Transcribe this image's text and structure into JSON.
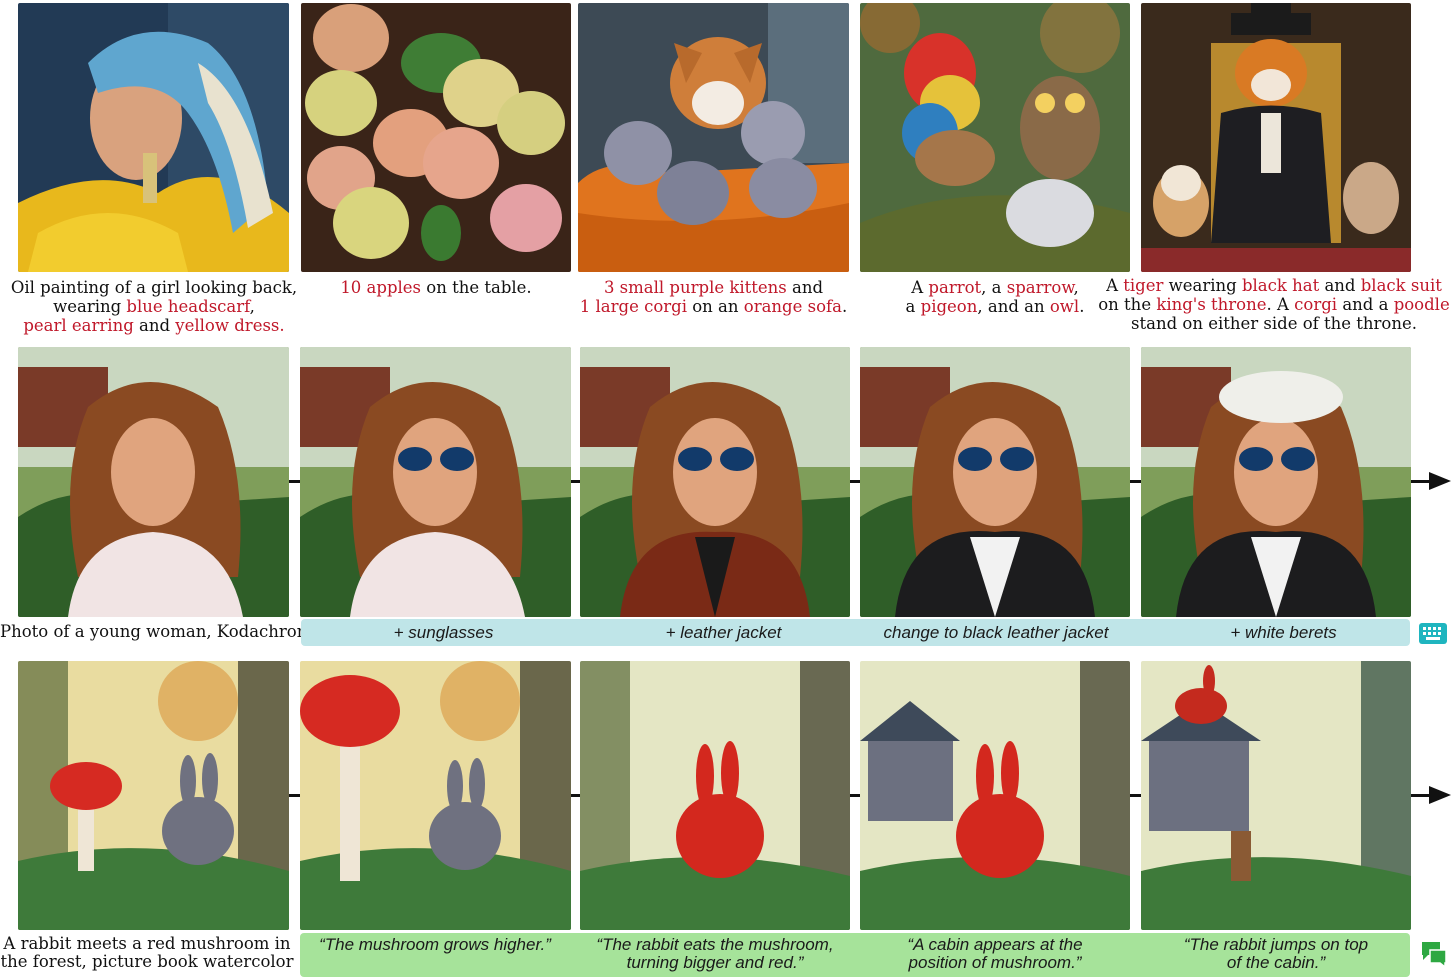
{
  "row1": {
    "captions": [
      {
        "parts": [
          {
            "t": "Oil painting of a girl looking back,",
            "h": false,
            "br": true
          },
          {
            "t": "wearing ",
            "h": false
          },
          {
            "t": "blue headscarf",
            "h": true
          },
          {
            "t": ",",
            "h": false,
            "br": true
          },
          {
            "t": "pearl earring",
            "h": true
          },
          {
            "t": " and ",
            "h": false
          },
          {
            "t": "yellow dress",
            "h": true
          },
          {
            "t": ".",
            "h": true
          }
        ]
      },
      {
        "parts": [
          {
            "t": "10 apples",
            "h": true
          },
          {
            "t": " on the table.",
            "h": false
          }
        ]
      },
      {
        "parts": [
          {
            "t": "3 small purple kittens",
            "h": true
          },
          {
            "t": " and",
            "h": false,
            "br": true
          },
          {
            "t": "1 large corgi",
            "h": true
          },
          {
            "t": " on an ",
            "h": false
          },
          {
            "t": "orange sofa",
            "h": true
          },
          {
            "t": ".",
            "h": false
          }
        ]
      },
      {
        "parts": [
          {
            "t": "A ",
            "h": false
          },
          {
            "t": "parrot",
            "h": true
          },
          {
            "t": ", a ",
            "h": false
          },
          {
            "t": "sparrow",
            "h": true
          },
          {
            "t": ",",
            "h": false,
            "br": true
          },
          {
            "t": "a ",
            "h": false
          },
          {
            "t": "pigeon",
            "h": true
          },
          {
            "t": ", and an ",
            "h": false
          },
          {
            "t": "owl",
            "h": true
          },
          {
            "t": ".",
            "h": false
          }
        ]
      },
      {
        "parts": [
          {
            "t": "A ",
            "h": false
          },
          {
            "t": "tiger",
            "h": true
          },
          {
            "t": " wearing ",
            "h": false
          },
          {
            "t": "black hat",
            "h": true
          },
          {
            "t": " and ",
            "h": false
          },
          {
            "t": "black suit",
            "h": true,
            "br": true
          },
          {
            "t": "on the ",
            "h": false
          },
          {
            "t": "king's throne",
            "h": true
          },
          {
            "t": ". A ",
            "h": false
          },
          {
            "t": "corgi",
            "h": true
          },
          {
            "t": " and a ",
            "h": false
          },
          {
            "t": "poodle",
            "h": true,
            "br": true
          },
          {
            "t": "stand on either side of the throne.",
            "h": false
          }
        ]
      }
    ]
  },
  "row2": {
    "prompt": "Photo of a young woman, Kodachrome",
    "steps": [
      "+ sunglasses",
      "+ leather jacket",
      "change to black leather jacket",
      "+ white berets"
    ]
  },
  "row3": {
    "prompt_line1": "A rabbit meets a red mushroom in",
    "prompt_line2": "the forest, picture book watercolor",
    "steps": [
      [
        "“The mushroom grows higher.”"
      ],
      [
        "“The rabbit eats the mushroom,",
        "turning bigger and red.”"
      ],
      [
        "“A cabin appears at the",
        "position of mushroom.”"
      ],
      [
        "“The rabbit jumps on top",
        "of the cabin.”"
      ]
    ]
  },
  "icons": {
    "edit": "keyboard-icon",
    "story": "chat-bubbles-icon"
  },
  "colors": {
    "highlight": "#c0182a",
    "edit_bar": "#bfe5e8",
    "story_bar": "#a6e39a",
    "icon_teal": "#1fb5bf",
    "icon_green": "#2ea842"
  }
}
